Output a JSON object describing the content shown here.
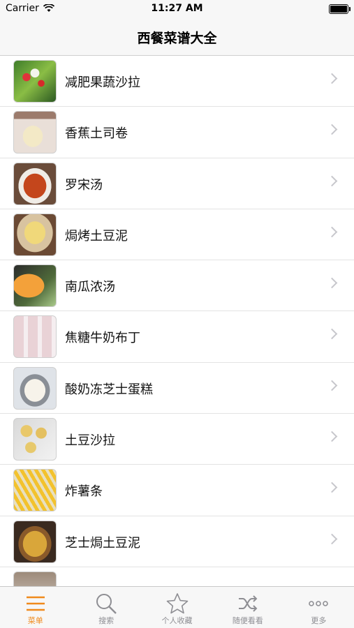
{
  "status_bar": {
    "carrier": "Carrier",
    "time": "11:27 AM"
  },
  "nav": {
    "title": "西餐菜谱大全"
  },
  "list": {
    "items": [
      {
        "label": "减肥果蔬沙拉",
        "thumb": "t1"
      },
      {
        "label": "香蕉土司卷",
        "thumb": "t2"
      },
      {
        "label": "罗宋汤",
        "thumb": "t3"
      },
      {
        "label": "焗烤土豆泥",
        "thumb": "t4"
      },
      {
        "label": "南瓜浓汤",
        "thumb": "t5"
      },
      {
        "label": "焦糖牛奶布丁",
        "thumb": "t6"
      },
      {
        "label": "酸奶冻芝士蛋糕",
        "thumb": "t7"
      },
      {
        "label": "土豆沙拉",
        "thumb": "t8"
      },
      {
        "label": "炸薯条",
        "thumb": "t9"
      },
      {
        "label": "芝士焗土豆泥",
        "thumb": "t10"
      },
      {
        "label": "",
        "thumb": "t11"
      }
    ]
  },
  "tab_bar": {
    "accent_color": "#f08a1c",
    "tabs": [
      {
        "label": "菜单",
        "icon": "menu-icon",
        "active": true
      },
      {
        "label": "搜索",
        "icon": "search-icon",
        "active": false
      },
      {
        "label": "个人收藏",
        "icon": "star-icon",
        "active": false
      },
      {
        "label": "随便看看",
        "icon": "shuffle-icon",
        "active": false
      },
      {
        "label": "更多",
        "icon": "more-icon",
        "active": false
      }
    ]
  }
}
